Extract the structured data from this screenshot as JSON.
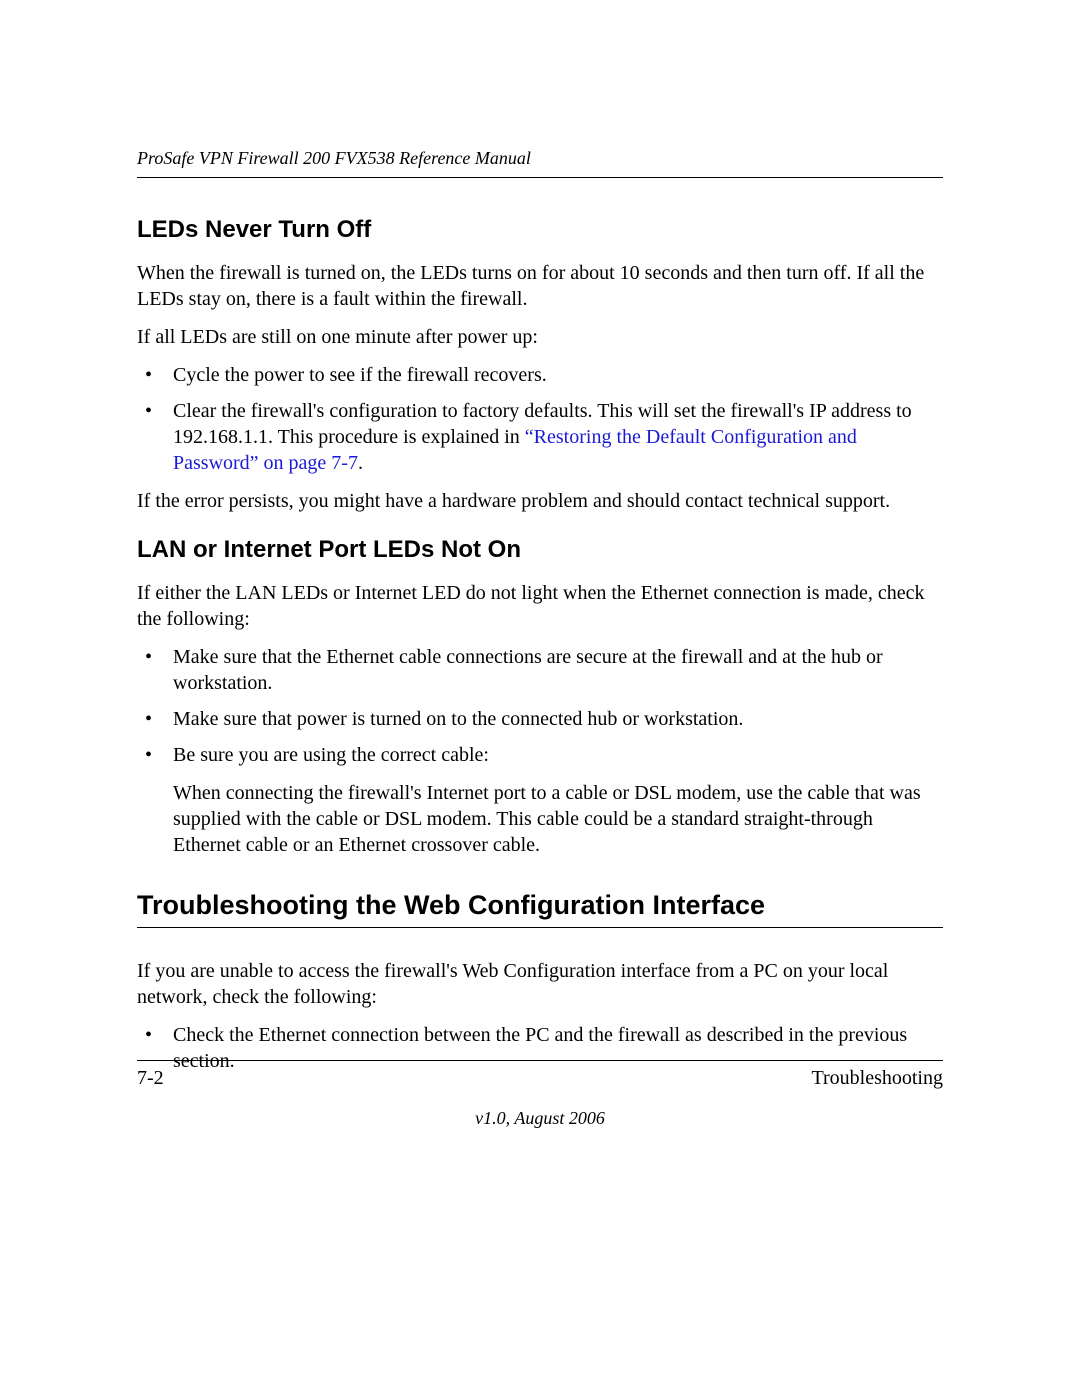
{
  "header": {
    "title": "ProSafe VPN Firewall 200 FVX538 Reference Manual"
  },
  "section1": {
    "heading": "LEDs Never Turn Off",
    "para1": "When the firewall is turned on, the LEDs turns on for about 10 seconds and then turn off. If all the LEDs stay on, there is a fault within the firewall.",
    "para2": "If all LEDs are still on one minute after power up:",
    "bullets": {
      "b1": "Cycle the power to see if the firewall recovers.",
      "b2_pre": "Clear the firewall's configuration to factory defaults. This will set the firewall's IP address to 192.168.1.1. This procedure is explained in ",
      "b2_link": "“Restoring the Default Configuration and Password” on page 7-7",
      "b2_post": "."
    },
    "para3": "If the error persists, you might have a hardware problem and should contact technical support."
  },
  "section2": {
    "heading": "LAN or Internet Port LEDs Not On",
    "para1": "If either the LAN LEDs or Internet LED do not light when the Ethernet connection is made, check the following:",
    "bullets": {
      "b1": "Make sure that the Ethernet cable connections are secure at the firewall and at the hub or workstation.",
      "b2": "Make sure that power is turned on to the connected hub or workstation.",
      "b3": "Be sure you are using the correct cable:"
    },
    "sub": "When connecting the firewall's Internet port to a cable or DSL modem, use the cable that was supplied with the cable or DSL modem. This cable could be a standard straight-through Ethernet cable or an Ethernet crossover cable."
  },
  "section3": {
    "heading": "Troubleshooting the Web Configuration Interface",
    "para1": "If you are unable to access the firewall's Web Configuration interface from a PC on your local network, check the following:",
    "bullets": {
      "b1": "Check the Ethernet connection between the PC and the firewall as described in the previous section."
    }
  },
  "footer": {
    "page": "7-2",
    "chapter": "Troubleshooting",
    "version": "v1.0, August 2006"
  }
}
